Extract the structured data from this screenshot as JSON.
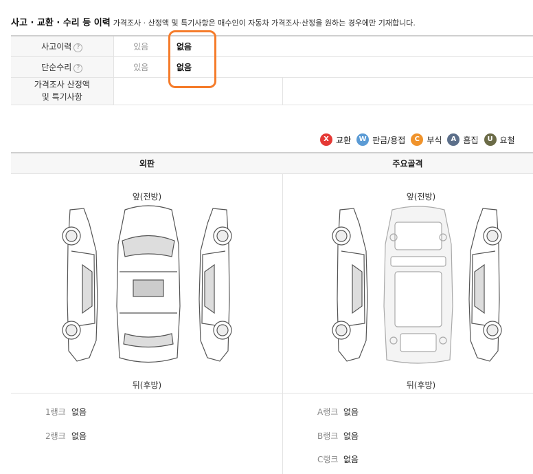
{
  "section": {
    "title": "사고 · 교환 · 수리 등 이력",
    "subtitle": "가격조사 · 산정액 및 특기사항은 매수인이 자동차 가격조사·산정을 원하는 경우에만 기재합니다."
  },
  "history": [
    {
      "label": "사고이력",
      "help": "?",
      "option_yes": "있음",
      "option_no": "없음"
    },
    {
      "label": "단순수리",
      "help": "?",
      "option_yes": "있음",
      "option_no": "없음"
    }
  ],
  "price_row": {
    "label_line1": "가격조사 산정액",
    "label_line2": "및 특기사항"
  },
  "legend": [
    {
      "code": "X",
      "label": "교환",
      "color": "#e53935"
    },
    {
      "code": "W",
      "label": "판금/용접",
      "color": "#5b9bd5"
    },
    {
      "code": "C",
      "label": "부식",
      "color": "#f0932b"
    },
    {
      "code": "A",
      "label": "흠집",
      "color": "#5c6f8a"
    },
    {
      "code": "U",
      "label": "요철",
      "color": "#6b6b47"
    }
  ],
  "panels": {
    "exterior": {
      "title": "외판",
      "front": "앞(전방)",
      "rear": "뒤(후방)",
      "ranks": [
        {
          "name": "1랭크",
          "value": "없음"
        },
        {
          "name": "2랭크",
          "value": "없음"
        }
      ]
    },
    "frame": {
      "title": "주요골격",
      "front": "앞(전방)",
      "rear": "뒤(후방)",
      "ranks": [
        {
          "name": "A랭크",
          "value": "없음"
        },
        {
          "name": "B랭크",
          "value": "없음"
        },
        {
          "name": "C랭크",
          "value": "없음"
        }
      ]
    }
  },
  "colors": {
    "highlight": "#f57c2b",
    "header_bg": "#f7f7f7"
  }
}
